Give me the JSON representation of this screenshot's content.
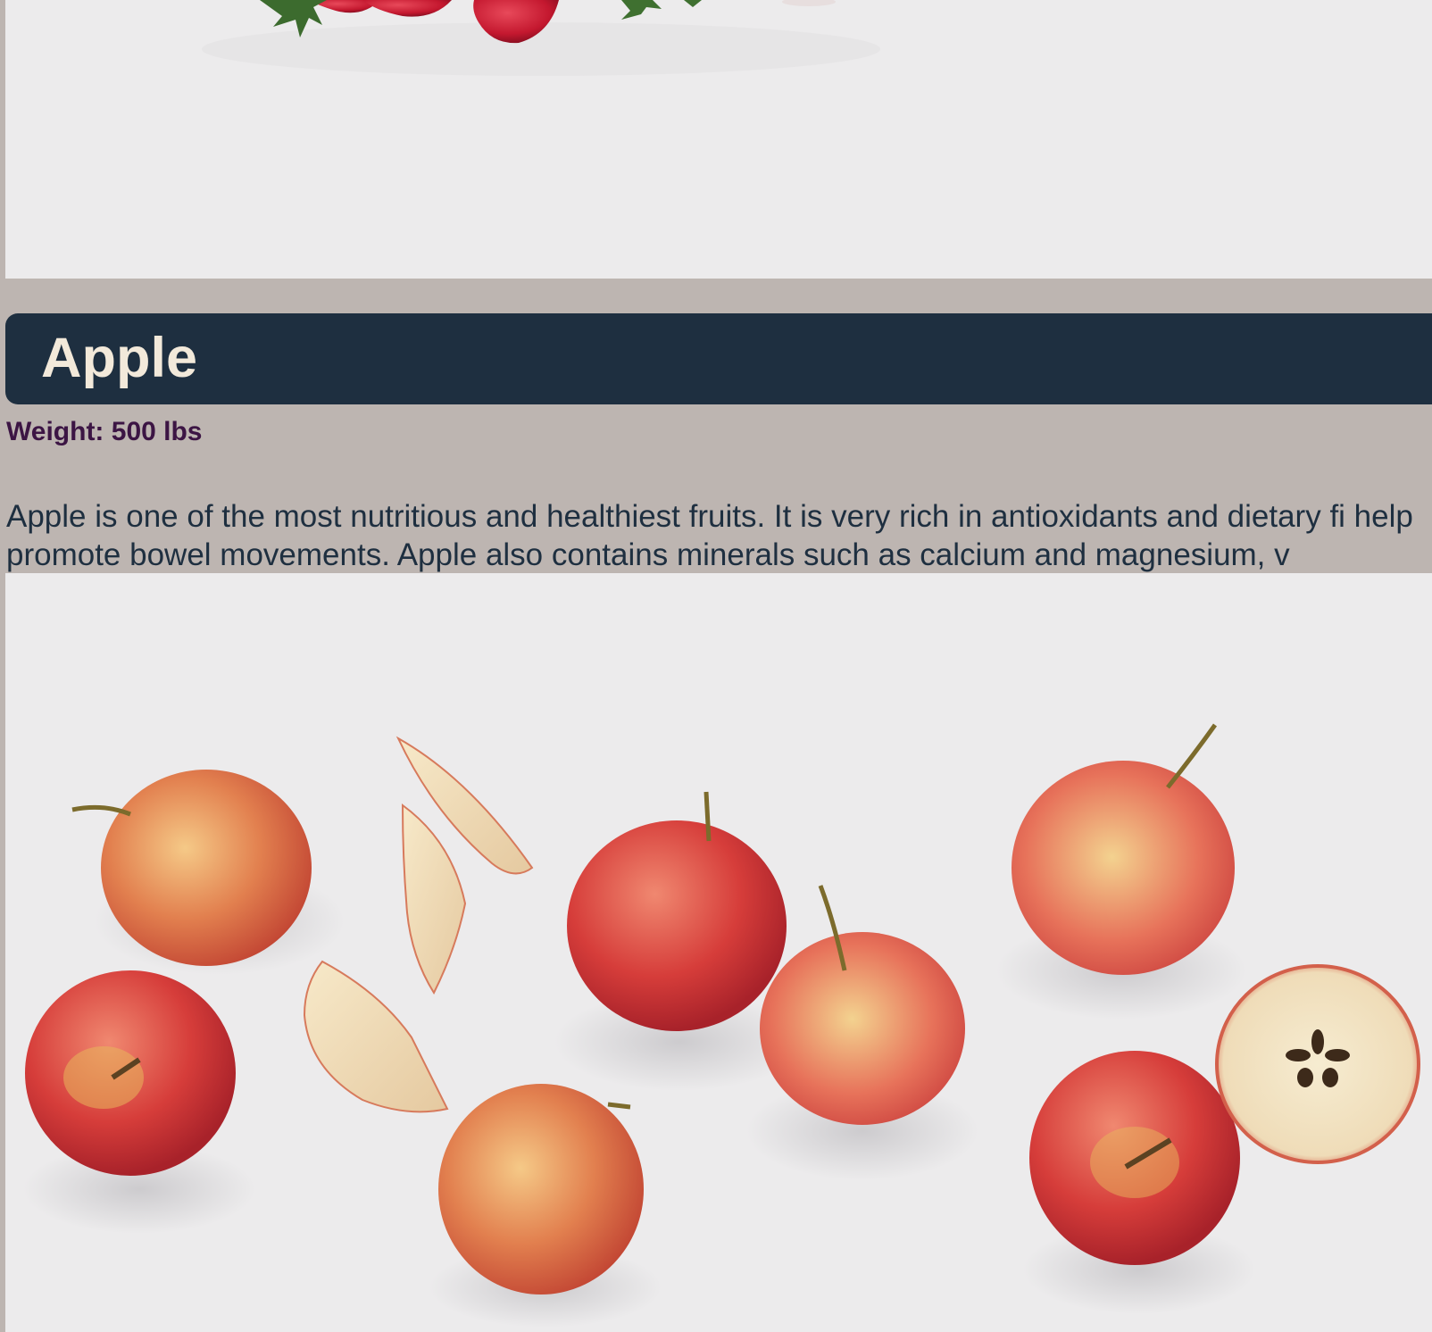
{
  "fruit": {
    "name": "Apple",
    "weight": "Weight: 500 lbs",
    "description": "Apple is one of the most nutritious and healthiest fruits. It is very rich in antioxidants and dietary fi help promote bowel movements. Apple also contains minerals such as calcium and magnesium, v"
  },
  "photos": {
    "top": {
      "subject": "strawberries on white surface"
    },
    "bottom": {
      "subject": "apples and apple slices on white surface"
    }
  },
  "colors": {
    "page_background": "#bdb5b1",
    "title_bar": "#1e2f40",
    "title_text": "#f2e9da",
    "weight_text": "#3c1544",
    "description_text": "#1e2f40",
    "photo_background": "#ecebec"
  }
}
